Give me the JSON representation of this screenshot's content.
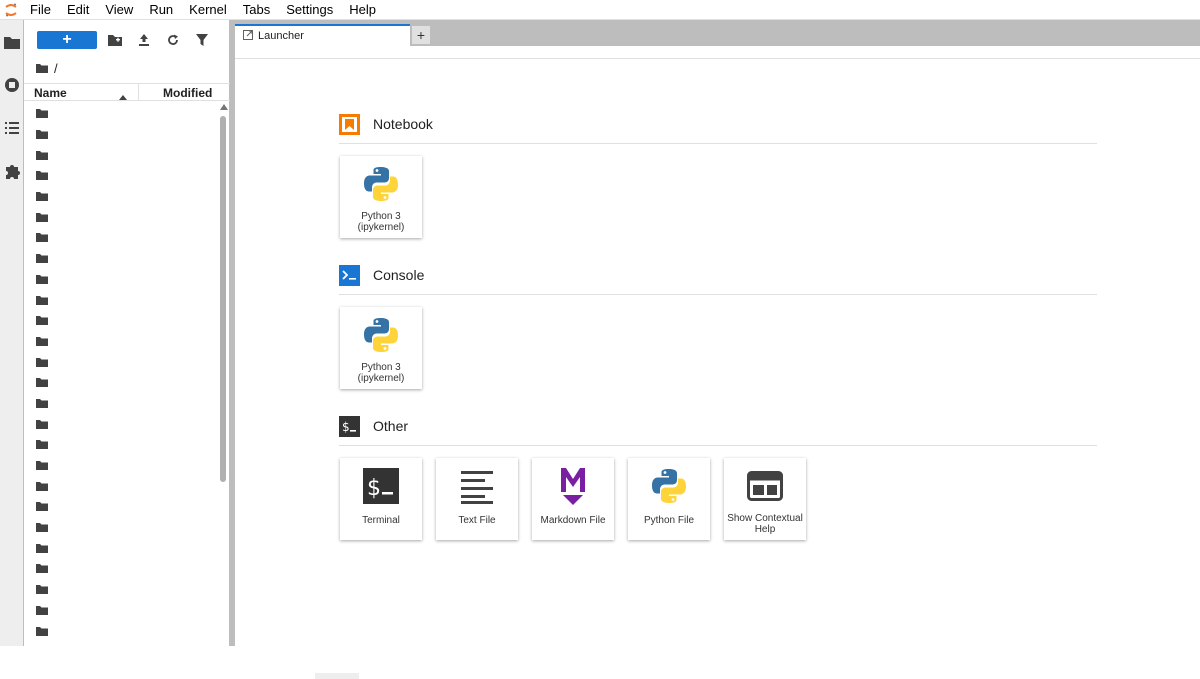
{
  "menubar": {
    "items": [
      "File",
      "Edit",
      "View",
      "Run",
      "Kernel",
      "Tabs",
      "Settings",
      "Help"
    ]
  },
  "filebrowser": {
    "new_label": "+",
    "breadcrumb": "/",
    "columns": {
      "name": "Name",
      "modified": "Modified"
    },
    "row_count": 26
  },
  "tabs": [
    {
      "label": "Launcher"
    }
  ],
  "tab_add_label": "+",
  "launcher": {
    "sections": [
      {
        "title": "Notebook",
        "cards": [
          {
            "line1": "Python 3",
            "line2": "(ipykernel)"
          }
        ]
      },
      {
        "title": "Console",
        "cards": [
          {
            "line1": "Python 3",
            "line2": "(ipykernel)"
          }
        ]
      },
      {
        "title": "Other",
        "cards": [
          {
            "line1": "Terminal",
            "line2": ""
          },
          {
            "line1": "Text File",
            "line2": ""
          },
          {
            "line1": "Markdown File",
            "line2": ""
          },
          {
            "line1": "Python File",
            "line2": ""
          },
          {
            "line1": "Show Contextual",
            "line2": "Help"
          }
        ]
      }
    ]
  },
  "colors": {
    "accent": "#1976d2",
    "notebook": "#f57c00",
    "markdown": "#7b1fa2",
    "python_blue": "#3572a5",
    "python_yellow": "#ffd43b"
  }
}
